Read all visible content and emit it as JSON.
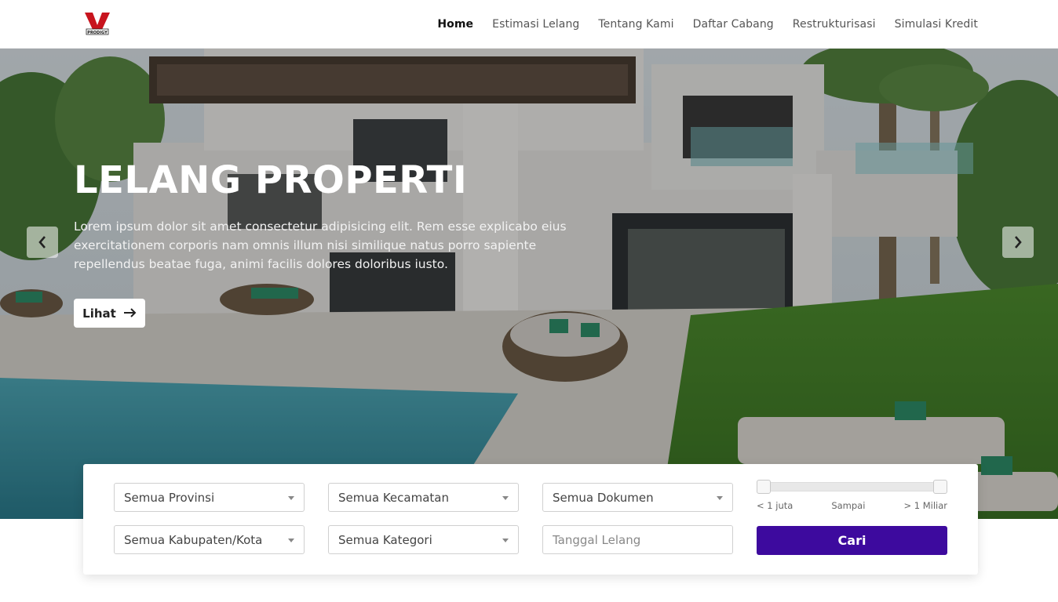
{
  "brand": {
    "logo_text": "PRODIGY",
    "logo_color": "#c8141e"
  },
  "nav": {
    "items": [
      {
        "label": "Home",
        "active": true
      },
      {
        "label": "Estimasi Lelang",
        "active": false
      },
      {
        "label": "Tentang Kami",
        "active": false
      },
      {
        "label": "Daftar Cabang",
        "active": false
      },
      {
        "label": "Restrukturisasi",
        "active": false
      },
      {
        "label": "Simulasi Kredit",
        "active": false
      }
    ]
  },
  "hero": {
    "title": "LELANG PROPERTI",
    "description": "Lorem ipsum dolor sit amet consectetur adipisicing elit. Rem esse explicabo eius exercitationem corporis nam omnis illum nisi similique natus porro sapiente repellendus beatae fuga, animi facilis dolores doloribus iusto.",
    "button_label": "Lihat",
    "button_icon": "arrow-right-icon",
    "prev_icon": "chevron-left-icon",
    "next_icon": "chevron-right-icon"
  },
  "search": {
    "provinsi": "Semua Provinsi",
    "kecamatan": "Semua Kecamatan",
    "dokumen": "Semua Dokumen",
    "kabupaten": "Semua Kabupaten/Kota",
    "kategori": "Semua Kategori",
    "tanggal_placeholder": "Tanggal Lelang",
    "price_range": {
      "min_label": "< 1 juta",
      "mid_label": "Sampai",
      "max_label": "> 1 Miliar",
      "min_value": 0,
      "max_value": 1
    },
    "button_label": "Cari",
    "button_color": "#3d0a9e"
  }
}
